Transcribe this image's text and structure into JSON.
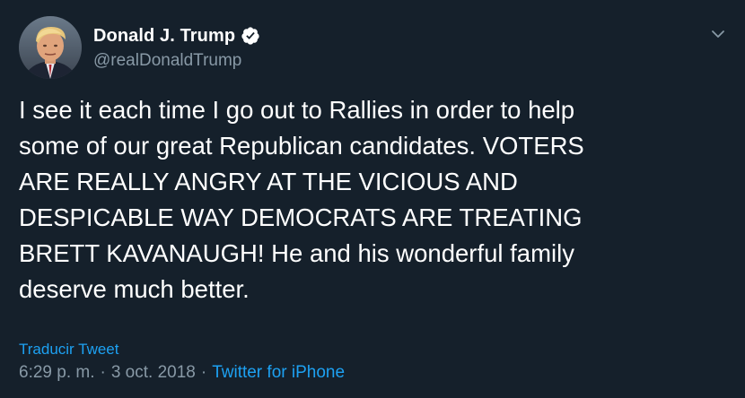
{
  "author": {
    "display_name": "Donald J. Trump",
    "handle": "@realDonaldTrump",
    "verified_icon": "verified-badge-icon"
  },
  "menu": {
    "icon": "chevron-down-icon"
  },
  "tweet": {
    "text": "I see it each time I go out to Rallies in order to help\nsome of our great Republican candidates. VOTERS\nARE REALLY ANGRY AT THE VICIOUS AND\nDESPICABLE WAY DEMOCRATS ARE TREATING\nBRETT KAVANAUGH! He and his wonderful family\ndeserve much better.",
    "translate_label": "Traducir Tweet",
    "time": "6:29 p. m.",
    "date": "3 oct. 2018",
    "separator": "·",
    "source": "Twitter for iPhone"
  },
  "colors": {
    "background": "#15202b",
    "text": "#ffffff",
    "secondary": "#8899a6",
    "accent": "#1da1f2"
  }
}
